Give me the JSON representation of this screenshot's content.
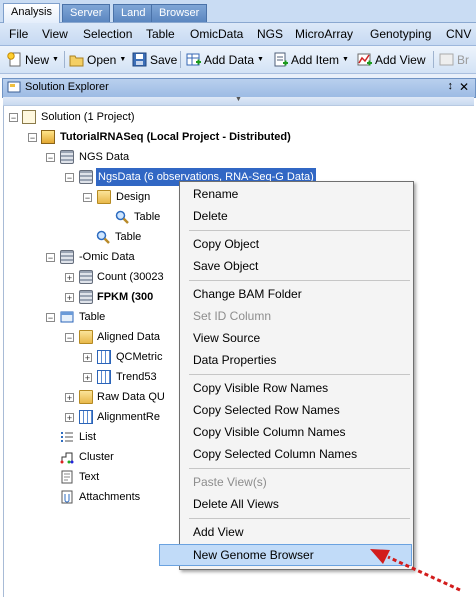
{
  "tabs": [
    "Analysis",
    "Server",
    "Land",
    "Browser"
  ],
  "menu": [
    "File",
    "View",
    "Selection",
    "Table",
    "OmicData",
    "NGS",
    "MicroArray",
    "Genotyping",
    "CNV"
  ],
  "toolbar": {
    "new": "New",
    "open": "Open",
    "save": "Save",
    "add_data": "Add Data",
    "add_item": "Add Item",
    "add_view": "Add View",
    "truncated": "Br"
  },
  "panel": {
    "title": "Solution Explorer",
    "pin": "↕",
    "close": "✕"
  },
  "tree": {
    "solution": "Solution (1 Project)",
    "project": "TutorialRNASeq (Local Project - Distributed)",
    "ngs_data": "NGS Data",
    "ngsdata_item": "NgsData (6 observations, RNA-Seq-G Data)",
    "design": "Design",
    "design_table": "Table",
    "ngs_table": "Table",
    "omic_data": "-Omic Data",
    "count": "Count (30023",
    "fpkm": "FPKM (300",
    "table_folder": "Table",
    "aligned_data": "Aligned Data",
    "qcmetric": "QCMetric",
    "trend53": "Trend53",
    "raw_data": "Raw Data QU",
    "alignment": "AlignmentRe",
    "list": "List",
    "cluster": "Cluster",
    "text": "Text",
    "attachments": "Attachments"
  },
  "context_menu": [
    [
      "Rename",
      "Delete"
    ],
    [
      "Copy Object",
      "Save Object"
    ],
    [
      "Change BAM Folder",
      "Set ID Column",
      "View Source",
      "Data Properties"
    ],
    [
      "Copy Visible Row Names",
      "Copy Selected Row Names",
      "Copy Visible Column Names",
      "Copy Selected Column Names"
    ],
    [
      "Paste View(s)",
      "Delete All Views"
    ],
    [
      "Add View",
      "New Genome Browser"
    ]
  ],
  "disabled_items": [
    "Set ID Column",
    "Paste View(s)"
  ],
  "highlighted_item": "New Genome Browser",
  "colors": {
    "selection": "#3167c4",
    "hover": "#c1dbf8",
    "arrow": "#d21c1c",
    "chrome": "#c6d9f2"
  }
}
